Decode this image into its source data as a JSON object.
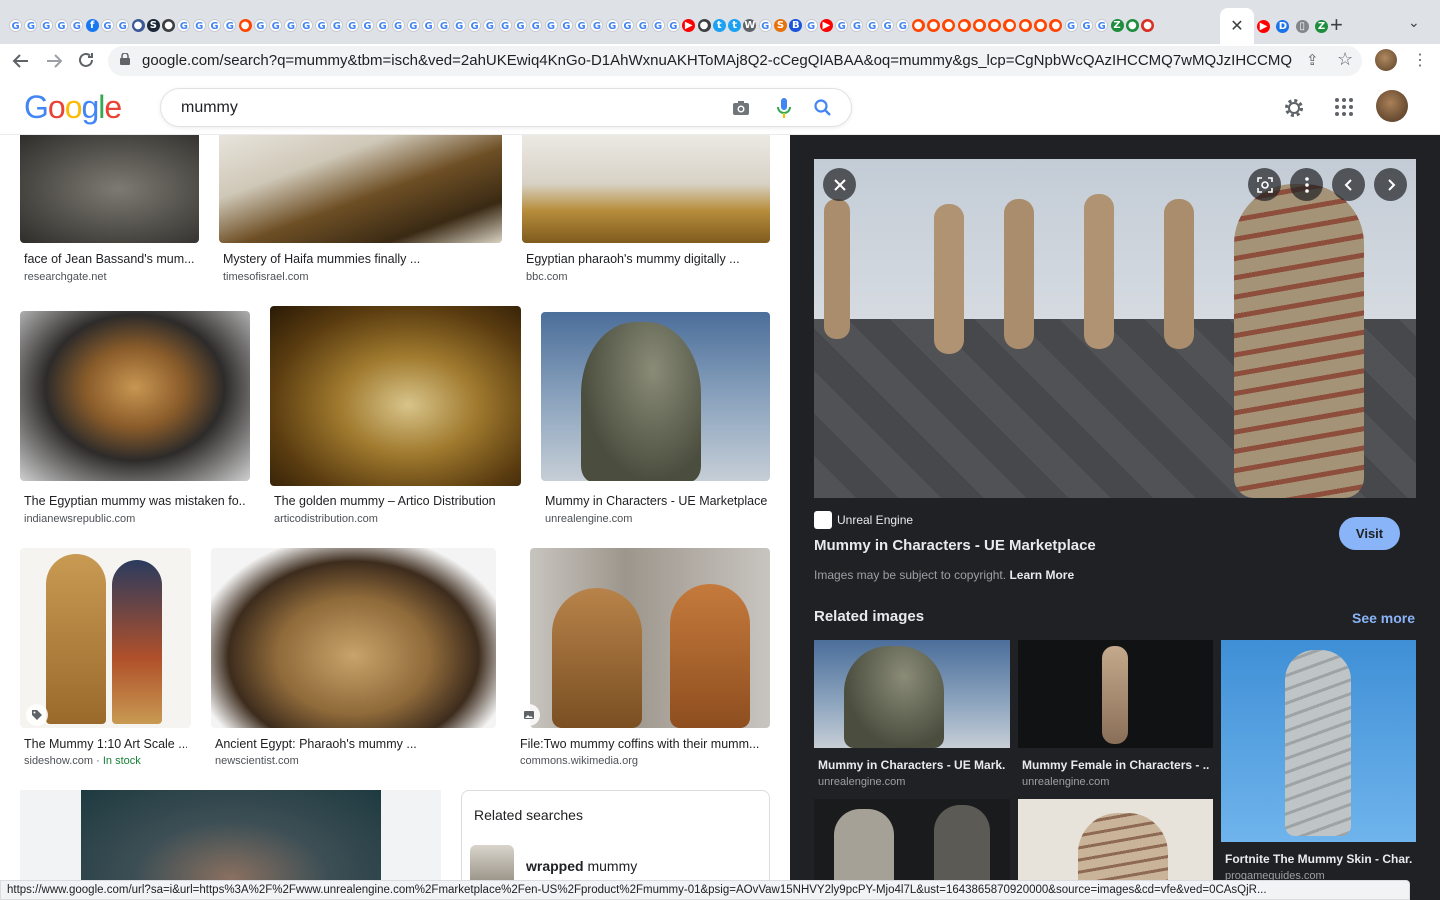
{
  "browser": {
    "url": "google.com/search?q=mummy&tbm=isch&ved=2ahUKEwiq4KnGo-D1AhWxnuAKHToMAj8Q2-cCegQIABAA&oq=mummy&gs_lcp=CgNpbWcQAzIHCCMQ7wMQJzIHCCMQ7wM...",
    "active_tab_close": "✕",
    "new_tab": "+",
    "tab_search": "⌄",
    "status_url": "https://www.google.com/url?sa=i&url=https%3A%2F%2Fwww.unrealengine.com%2Fmarketplace%2Fen-US%2Fproduct%2Fmummy-01&psig=AOvVaw15NHVY2ly9pcPY-Mjo4l7L&ust=1643865870920000&source=images&cd=vfe&ved=0CAsQjR...",
    "tab_favicons": [
      {
        "letter": "G",
        "color": "#4285f4"
      },
      {
        "letter": "G",
        "color": "#4285f4"
      },
      {
        "letter": "G",
        "color": "#4285f4"
      },
      {
        "letter": "G",
        "color": "#4285f4"
      },
      {
        "letter": "G",
        "color": "#4285f4"
      },
      {
        "letter": "f",
        "color": "#1877f2"
      },
      {
        "letter": "G",
        "color": "#4285f4"
      },
      {
        "letter": "G",
        "color": "#4285f4"
      },
      {
        "letter": "●",
        "color": "#3b5998"
      },
      {
        "letter": "S",
        "color": "#1b2838"
      },
      {
        "letter": "●",
        "color": "#3c4043"
      },
      {
        "letter": "G",
        "color": "#4285f4"
      },
      {
        "letter": "G",
        "color": "#4285f4"
      },
      {
        "letter": "G",
        "color": "#4285f4"
      },
      {
        "letter": "G",
        "color": "#4285f4"
      },
      {
        "letter": "●",
        "color": "#ff4500"
      },
      {
        "letter": "G",
        "color": "#4285f4"
      },
      {
        "letter": "G",
        "color": "#4285f4"
      },
      {
        "letter": "G",
        "color": "#4285f4"
      },
      {
        "letter": "G",
        "color": "#4285f4"
      },
      {
        "letter": "G",
        "color": "#4285f4"
      },
      {
        "letter": "G",
        "color": "#4285f4"
      },
      {
        "letter": "G",
        "color": "#4285f4"
      },
      {
        "letter": "G",
        "color": "#4285f4"
      },
      {
        "letter": "G",
        "color": "#4285f4"
      },
      {
        "letter": "G",
        "color": "#4285f4"
      },
      {
        "letter": "G",
        "color": "#4285f4"
      },
      {
        "letter": "G",
        "color": "#4285f4"
      },
      {
        "letter": "G",
        "color": "#4285f4"
      },
      {
        "letter": "G",
        "color": "#4285f4"
      },
      {
        "letter": "G",
        "color": "#4285f4"
      },
      {
        "letter": "G",
        "color": "#4285f4"
      },
      {
        "letter": "G",
        "color": "#4285f4"
      },
      {
        "letter": "G",
        "color": "#4285f4"
      },
      {
        "letter": "G",
        "color": "#4285f4"
      },
      {
        "letter": "G",
        "color": "#4285f4"
      },
      {
        "letter": "G",
        "color": "#4285f4"
      },
      {
        "letter": "G",
        "color": "#4285f4"
      },
      {
        "letter": "G",
        "color": "#4285f4"
      },
      {
        "letter": "G",
        "color": "#4285f4"
      },
      {
        "letter": "G",
        "color": "#4285f4"
      },
      {
        "letter": "G",
        "color": "#4285f4"
      },
      {
        "letter": "G",
        "color": "#4285f4"
      },
      {
        "letter": "G",
        "color": "#4285f4"
      },
      {
        "letter": "▶",
        "color": "#ff0000"
      },
      {
        "letter": "●",
        "color": "#3c4043"
      },
      {
        "letter": "t",
        "color": "#1da1f2"
      },
      {
        "letter": "t",
        "color": "#1da1f2"
      },
      {
        "letter": "W",
        "color": "#5f6368"
      },
      {
        "letter": "G",
        "color": "#4285f4"
      },
      {
        "letter": "S",
        "color": "#e8710a"
      },
      {
        "letter": "B",
        "color": "#1a56db"
      },
      {
        "letter": "G",
        "color": "#4285f4"
      },
      {
        "letter": "▶",
        "color": "#ff0000"
      },
      {
        "letter": "G",
        "color": "#4285f4"
      },
      {
        "letter": "G",
        "color": "#4285f4"
      },
      {
        "letter": "G",
        "color": "#4285f4"
      },
      {
        "letter": "G",
        "color": "#4285f4"
      },
      {
        "letter": "G",
        "color": "#4285f4"
      },
      {
        "letter": "●",
        "color": "#ff4500"
      },
      {
        "letter": "●",
        "color": "#ff4500"
      },
      {
        "letter": "●",
        "color": "#ff4500"
      },
      {
        "letter": "●",
        "color": "#ff4500"
      },
      {
        "letter": "●",
        "color": "#ff4500"
      },
      {
        "letter": "●",
        "color": "#ff4500"
      },
      {
        "letter": "●",
        "color": "#ff4500"
      },
      {
        "letter": "●",
        "color": "#ff4500"
      },
      {
        "letter": "●",
        "color": "#ff4500"
      },
      {
        "letter": "●",
        "color": "#ff4500"
      },
      {
        "letter": "G",
        "color": "#4285f4"
      },
      {
        "letter": "G",
        "color": "#4285f4"
      },
      {
        "letter": "G",
        "color": "#4285f4"
      },
      {
        "letter": "Z",
        "color": "#1e8e3e"
      },
      {
        "letter": "●",
        "color": "#1e8e3e"
      },
      {
        "letter": "●",
        "color": "#d93025"
      }
    ],
    "tail_tab_favicons": [
      {
        "letter": "▶",
        "color": "#ff0000"
      },
      {
        "letter": "D",
        "color": "#1a73e8"
      },
      {
        "letter": "▯",
        "color": "#80868b"
      },
      {
        "letter": "Z",
        "color": "#1e8e3e"
      }
    ]
  },
  "header": {
    "logo": [
      "G",
      "o",
      "o",
      "g",
      "l",
      "e"
    ],
    "logo_colors": [
      "#4285f4",
      "#ea4335",
      "#fbbc05",
      "#4285f4",
      "#34a853",
      "#ea4335"
    ],
    "query": "mummy"
  },
  "results": [
    {
      "title": "face of Jean Bassand's mum...",
      "source": "researchgate.net"
    },
    {
      "title": "Mystery of Haifa mummies finally ...",
      "source": "timesofisrael.com"
    },
    {
      "title": "Egyptian pharaoh's mummy digitally ...",
      "source": "bbc.com"
    },
    {
      "title": "The Egyptian mummy was mistaken fo...",
      "source": "indianewsrepublic.com"
    },
    {
      "title": "The golden mummy – Artico Distribution",
      "source": "articodistribution.com"
    },
    {
      "title": "Mummy in Characters - UE Marketplace",
      "source": "unrealengine.com"
    },
    {
      "title": "The Mummy 1:10 Art Scale ...",
      "source": "sideshow.com",
      "stock": "In stock"
    },
    {
      "title": "Ancient Egypt: Pharaoh's mummy ...",
      "source": "newscientist.com"
    },
    {
      "title": "File:Two mummy coffins with their mumm...",
      "source": "commons.wikimedia.org"
    }
  ],
  "related_searches": {
    "title": "Related searches",
    "item_bold": "wrapped",
    "item_rest": " mummy"
  },
  "preview": {
    "site_name": "Unreal Engine",
    "title": "Mummy in Characters - UE Marketplace",
    "visit_label": "Visit",
    "copyright_text": "Images may be subject to copyright.",
    "learn_more": "Learn More",
    "related_images_label": "Related images",
    "see_more_label": "See more",
    "related": [
      {
        "title": "Mummy in Characters - UE Mark...",
        "source": "unrealengine.com"
      },
      {
        "title": "Mummy Female in Characters - ...",
        "source": "unrealengine.com"
      },
      {
        "title": "Fortnite The Mummy Skin - Char...",
        "source": "progameguides.com"
      }
    ]
  }
}
